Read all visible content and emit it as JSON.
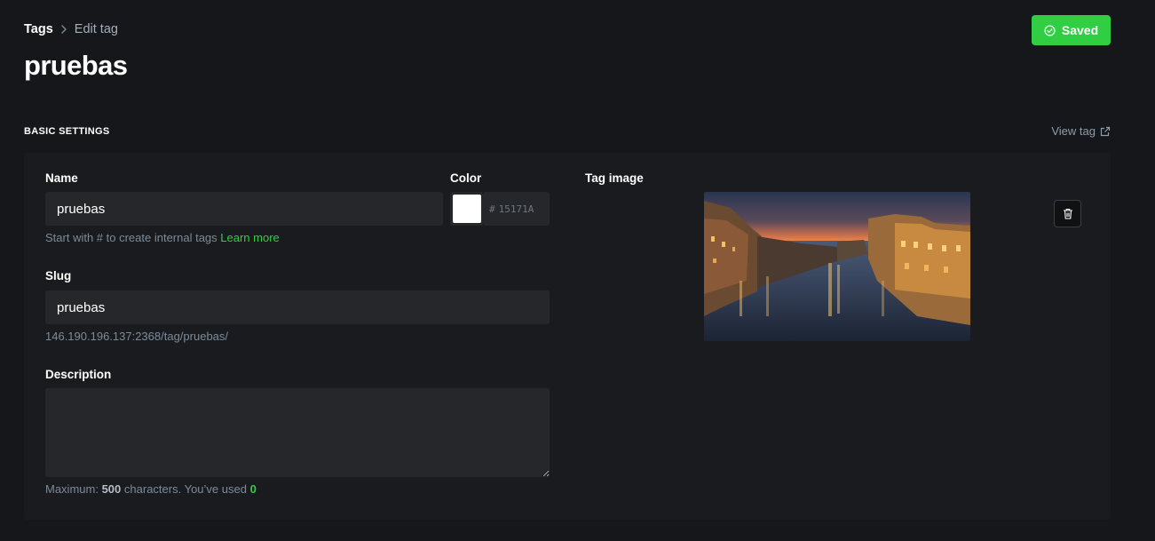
{
  "header": {
    "breadcrumb_root": "Tags",
    "breadcrumb_current": "Edit tag",
    "title": "pruebas",
    "save_label": "Saved"
  },
  "section": {
    "title": "BASIC SETTINGS",
    "view_tag_label": "View tag"
  },
  "form": {
    "name_label": "Name",
    "name_value": "pruebas",
    "name_hint": "Start with # to create internal tags",
    "name_hint_link": "Learn more",
    "color_label": "Color",
    "color_hash": "#",
    "color_value": "15171A",
    "slug_label": "Slug",
    "slug_value": "pruebas",
    "slug_url": "146.190.196.137:2368/tag/pruebas/",
    "description_label": "Description",
    "description_value": "",
    "description_hint_prefix": "Maximum:",
    "description_max": "500",
    "description_hint_mid": "characters. You’ve used",
    "description_used": "0",
    "tag_image_label": "Tag image"
  },
  "icons": {
    "save": "check-circle-icon",
    "breadcrumb_separator": "chevron-right-icon",
    "view_tag": "external-link-icon",
    "delete": "trash-icon"
  },
  "colors": {
    "accent": "#30cf43",
    "background": "#15171a",
    "card": "#191b1f",
    "input": "#25272b",
    "swatch": "#ffffff"
  }
}
